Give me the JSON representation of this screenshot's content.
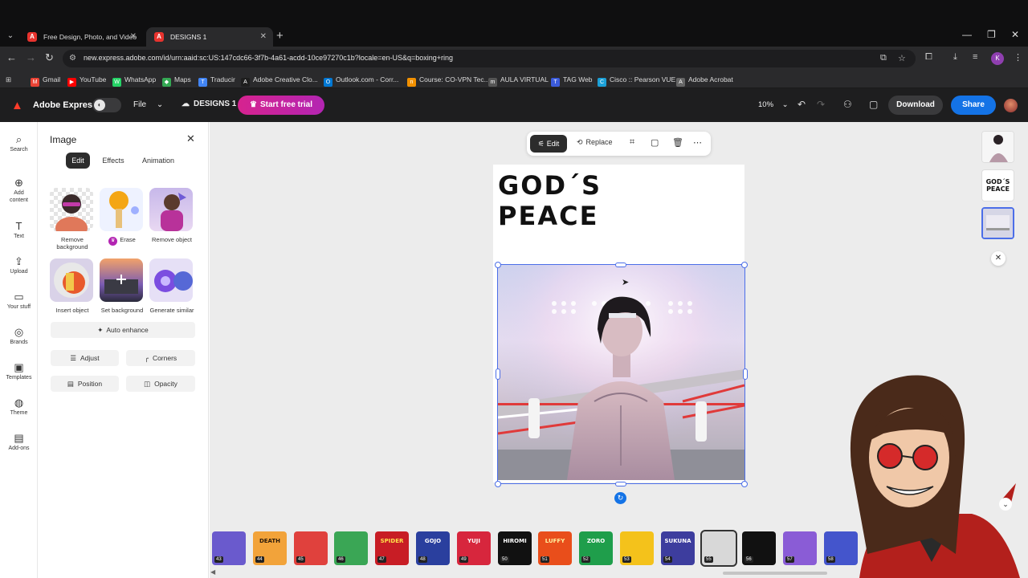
{
  "browser": {
    "tabs": [
      {
        "label": "Free Design, Photo, and Video"
      },
      {
        "label": "DESIGNS 1"
      }
    ],
    "url": "new.express.adobe.com/id/urn:aaid:sc:US:147cdc66-3f7b-4a61-acdd-10ce97270c1b?locale=en-US&q=boxing+ring",
    "bookmarks": [
      {
        "label": "Gmail",
        "color": "#ea4335",
        "icon": "M"
      },
      {
        "label": "YouTube",
        "color": "#ff0000",
        "icon": "▶"
      },
      {
        "label": "WhatsApp",
        "color": "#25d366",
        "icon": "W"
      },
      {
        "label": "Maps",
        "color": "#34a853",
        "icon": "◆"
      },
      {
        "label": "Traducir",
        "color": "#4285f4",
        "icon": "T"
      },
      {
        "label": "Adobe Creative Clo...",
        "color": "#1e1e1e",
        "icon": "A"
      },
      {
        "label": "Outlook.com - Corr...",
        "color": "#0078d4",
        "icon": "O"
      },
      {
        "label": "Course: CO-VPN Tec...",
        "color": "#f29100",
        "icon": "n"
      },
      {
        "label": "AULA VIRTUAL",
        "color": "#555555",
        "icon": "m"
      },
      {
        "label": "TAG Web",
        "color": "#3b5bdb",
        "icon": "T"
      },
      {
        "label": "Cisco :: Pearson VUE",
        "color": "#1ba0d7",
        "icon": "C"
      },
      {
        "label": "Adobe Acrobat",
        "color": "#666666",
        "icon": "A"
      }
    ],
    "profile_initial": "K"
  },
  "app": {
    "name": "Adobe Express",
    "file_label": "File",
    "doc_name": "DESIGNS 1",
    "trial_label": "Start free trial",
    "zoom": "10%",
    "download_label": "Download",
    "share_label": "Share"
  },
  "rail": {
    "items": [
      {
        "label": "Search",
        "icon": "⌕"
      },
      {
        "label": "Add content",
        "icon": "⊕"
      },
      {
        "label": "Text",
        "icon": "T"
      },
      {
        "label": "Upload",
        "icon": "⇪"
      },
      {
        "label": "Your stuff",
        "icon": "▭"
      },
      {
        "label": "Brands",
        "icon": "◎"
      },
      {
        "label": "Templates",
        "icon": "▣"
      },
      {
        "label": "Theme",
        "icon": "◍"
      },
      {
        "label": "Add-ons",
        "icon": "▤"
      }
    ]
  },
  "panel": {
    "title": "Image",
    "tabs": [
      "Edit",
      "Effects",
      "Animation"
    ],
    "tools": [
      {
        "label": "Remove background"
      },
      {
        "label": "Erase"
      },
      {
        "label": "Remove object"
      },
      {
        "label": "Insert object"
      },
      {
        "label": "Set background"
      },
      {
        "label": "Generate similar"
      }
    ],
    "auto_enhance": "Auto enhance",
    "buttons": [
      {
        "label": "Adjust"
      },
      {
        "label": "Corners"
      },
      {
        "label": "Position"
      },
      {
        "label": "Opacity"
      }
    ]
  },
  "context_bar": {
    "edit_label": "Edit",
    "replace_label": "Replace"
  },
  "canvas": {
    "headline_line1": "GOD´S",
    "headline_line2": "PEACE"
  },
  "right_thumbs": {
    "text_thumb_line1": "GOD´S",
    "text_thumb_line2": "PEACE"
  },
  "filmstrip": [
    {
      "num": "43",
      "bg": "#6a5acd",
      "fg": "#ffb000",
      "text": ""
    },
    {
      "num": "44",
      "bg": "#f2a33a",
      "fg": "#2b1a0a",
      "text": "DEATH"
    },
    {
      "num": "45",
      "bg": "#e0413d",
      "fg": "#ffd84a",
      "text": ""
    },
    {
      "num": "46",
      "bg": "#3aa655",
      "fg": "#111111",
      "text": ""
    },
    {
      "num": "47",
      "bg": "#c81d25",
      "fg": "#ffe14a",
      "text": "SPIDER"
    },
    {
      "num": "48",
      "bg": "#2a3f9e",
      "fg": "#ffffff",
      "text": "GOJO"
    },
    {
      "num": "49",
      "bg": "#d7263d",
      "fg": "#ffffff",
      "text": "YUJI"
    },
    {
      "num": "50",
      "bg": "#111111",
      "fg": "#ffffff",
      "text": "HIROMI"
    },
    {
      "num": "51",
      "bg": "#e94e1b",
      "fg": "#fff2a0",
      "text": "LUFFY"
    },
    {
      "num": "52",
      "bg": "#1f9e4b",
      "fg": "#ffffff",
      "text": "ZORO"
    },
    {
      "num": "53",
      "bg": "#f4c21b",
      "fg": "#222222",
      "text": ""
    },
    {
      "num": "54",
      "bg": "#3d3d9e",
      "fg": "#ffffff",
      "text": "SUKUNA"
    },
    {
      "num": "55",
      "bg": "#d8d8d8",
      "fg": "#333333",
      "text": ""
    },
    {
      "num": "56",
      "bg": "#111111",
      "fg": "#ffffff",
      "text": ""
    },
    {
      "num": "57",
      "bg": "#8a5cd6",
      "fg": "#ffffff",
      "text": ""
    },
    {
      "num": "58",
      "bg": "#4455cc",
      "fg": "#ffffff",
      "text": ""
    }
  ],
  "colors": {
    "accent_blue": "#1473e6",
    "selection": "#4b6ee8",
    "trial_gradient_start": "#d6238f"
  }
}
